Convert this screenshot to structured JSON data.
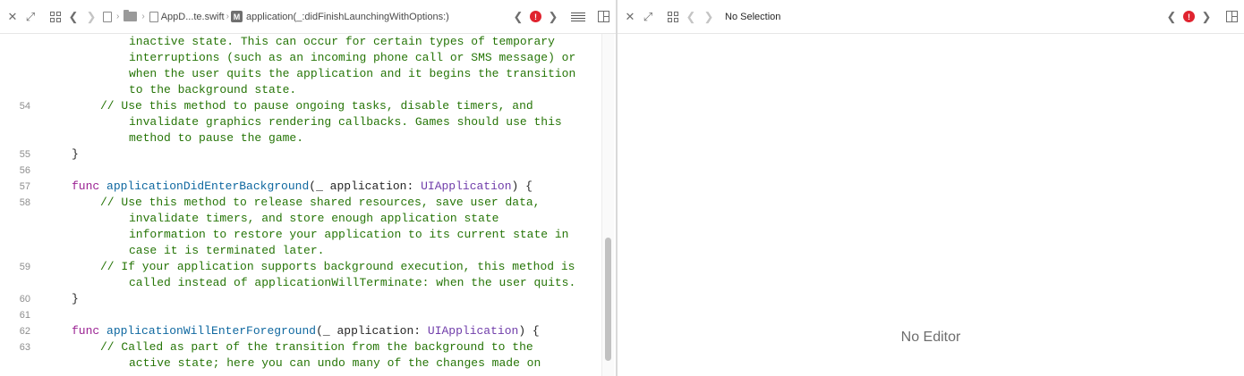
{
  "left_editor": {
    "breadcrumb": {
      "file": "AppD...te.swift",
      "symbol_badge": "M",
      "symbol": "application(_:didFinishLaunchingWithOptions:)",
      "error_badge": "!"
    },
    "lines": [
      {
        "num": "",
        "indent": 8,
        "segments": [
          {
            "cls": "comment",
            "text": "inactive state. This can occur for certain types of temporary"
          }
        ]
      },
      {
        "num": "",
        "indent": 8,
        "segments": [
          {
            "cls": "comment",
            "text": "interruptions (such as an incoming phone call or SMS message) or"
          }
        ]
      },
      {
        "num": "",
        "indent": 8,
        "segments": [
          {
            "cls": "comment",
            "text": "when the user quits the application and it begins the transition"
          }
        ]
      },
      {
        "num": "",
        "indent": 8,
        "segments": [
          {
            "cls": "comment",
            "text": "to the background state."
          }
        ]
      },
      {
        "num": "54",
        "indent": 4,
        "segments": [
          {
            "cls": "comment",
            "text": "// Use this method to pause ongoing tasks, disable timers, and"
          }
        ]
      },
      {
        "num": "",
        "indent": 8,
        "segments": [
          {
            "cls": "comment",
            "text": "invalidate graphics rendering callbacks. Games should use this"
          }
        ]
      },
      {
        "num": "",
        "indent": 8,
        "segments": [
          {
            "cls": "comment",
            "text": "method to pause the game."
          }
        ]
      },
      {
        "num": "55",
        "indent": 0,
        "segments": [
          {
            "cls": "",
            "text": "}"
          }
        ]
      },
      {
        "num": "56",
        "indent": 0,
        "segments": []
      },
      {
        "num": "57",
        "indent": 0,
        "segments": [
          {
            "cls": "kw",
            "text": "func "
          },
          {
            "cls": "fn",
            "text": "applicationDidEnterBackground"
          },
          {
            "cls": "",
            "text": "(_ application: "
          },
          {
            "cls": "type",
            "text": "UIApplication"
          },
          {
            "cls": "",
            "text": ") {"
          }
        ]
      },
      {
        "num": "58",
        "indent": 4,
        "segments": [
          {
            "cls": "comment",
            "text": "// Use this method to release shared resources, save user data,"
          }
        ]
      },
      {
        "num": "",
        "indent": 8,
        "segments": [
          {
            "cls": "comment",
            "text": "invalidate timers, and store enough application state"
          }
        ]
      },
      {
        "num": "",
        "indent": 8,
        "segments": [
          {
            "cls": "comment",
            "text": "information to restore your application to its current state in"
          }
        ]
      },
      {
        "num": "",
        "indent": 8,
        "segments": [
          {
            "cls": "comment",
            "text": "case it is terminated later."
          }
        ]
      },
      {
        "num": "59",
        "indent": 4,
        "segments": [
          {
            "cls": "comment",
            "text": "// If your application supports background execution, this method is"
          }
        ]
      },
      {
        "num": "",
        "indent": 8,
        "segments": [
          {
            "cls": "comment",
            "text": "called instead of applicationWillTerminate: when the user quits."
          }
        ]
      },
      {
        "num": "60",
        "indent": 0,
        "segments": [
          {
            "cls": "",
            "text": "}"
          }
        ]
      },
      {
        "num": "61",
        "indent": 0,
        "segments": []
      },
      {
        "num": "62",
        "indent": 0,
        "segments": [
          {
            "cls": "kw",
            "text": "func "
          },
          {
            "cls": "fn",
            "text": "applicationWillEnterForeground"
          },
          {
            "cls": "",
            "text": "(_ application: "
          },
          {
            "cls": "type",
            "text": "UIApplication"
          },
          {
            "cls": "",
            "text": ") {"
          }
        ]
      },
      {
        "num": "63",
        "indent": 4,
        "segments": [
          {
            "cls": "comment",
            "text": "// Called as part of the transition from the background to the"
          }
        ]
      },
      {
        "num": "",
        "indent": 8,
        "segments": [
          {
            "cls": "comment",
            "text": "active state; here you can undo many of the changes made on"
          }
        ]
      }
    ]
  },
  "right_editor": {
    "selection_label": "No Selection",
    "error_badge": "!",
    "placeholder": "No Editor"
  },
  "colors": {
    "comment": "#267507",
    "keyword": "#9b2393",
    "function": "#0f68a0",
    "type": "#703daa",
    "error": "#e0232f"
  }
}
